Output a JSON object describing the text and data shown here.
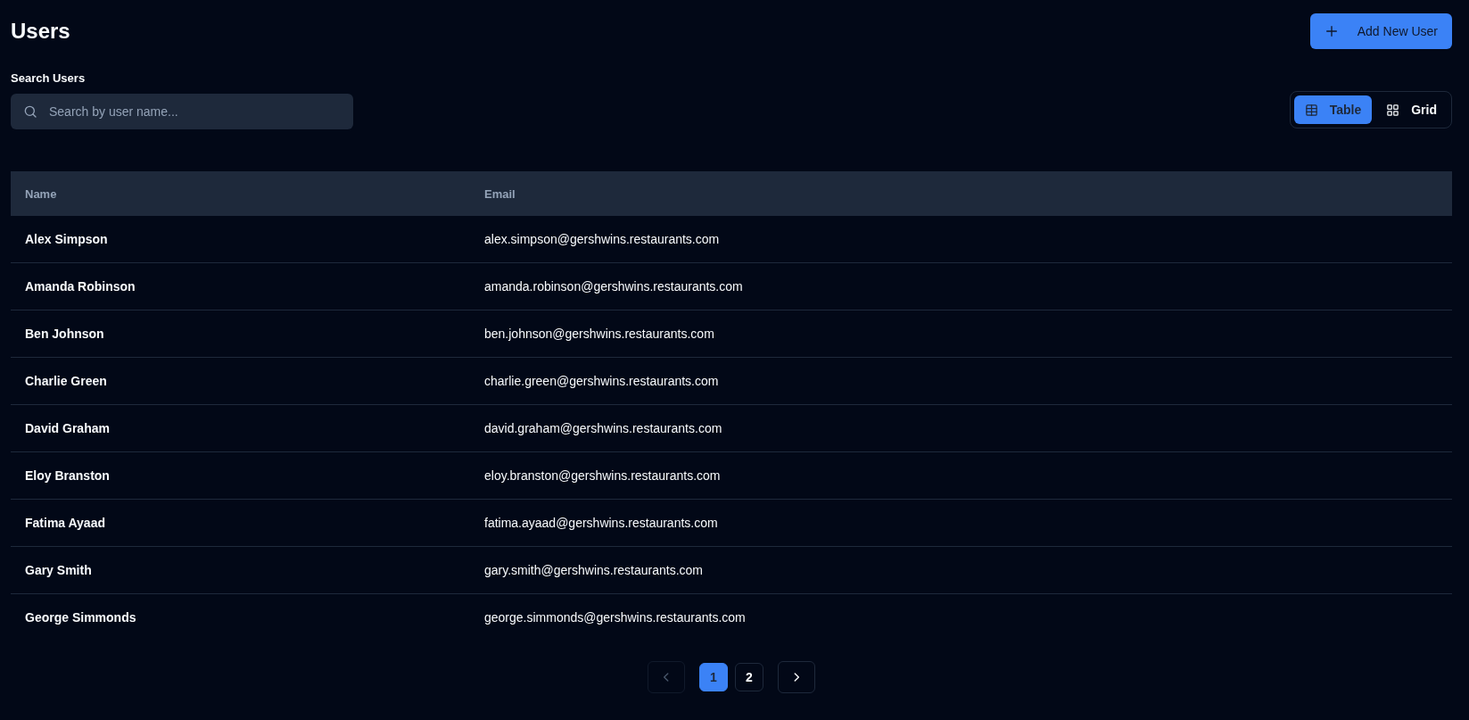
{
  "page": {
    "title": "Users"
  },
  "add_button": {
    "label": "Add New User"
  },
  "search": {
    "label": "Search Users",
    "placeholder": "Search by user name..."
  },
  "view_toggle": [
    {
      "label": "Table",
      "kind": "table",
      "selected": true
    },
    {
      "label": "Grid",
      "kind": "grid",
      "selected": false
    }
  ],
  "table": {
    "columns": [
      "Name",
      "Email"
    ],
    "rows": [
      {
        "name": "Alex Simpson",
        "email": "alex.simpson@gershwins.restaurants.com"
      },
      {
        "name": "Amanda Robinson",
        "email": "amanda.robinson@gershwins.restaurants.com"
      },
      {
        "name": "Ben Johnson",
        "email": "ben.johnson@gershwins.restaurants.com"
      },
      {
        "name": "Charlie Green",
        "email": "charlie.green@gershwins.restaurants.com"
      },
      {
        "name": "David Graham",
        "email": "david.graham@gershwins.restaurants.com"
      },
      {
        "name": "Eloy Branston",
        "email": "eloy.branston@gershwins.restaurants.com"
      },
      {
        "name": "Fatima Ayaad",
        "email": "fatima.ayaad@gershwins.restaurants.com"
      },
      {
        "name": "Gary Smith",
        "email": "gary.smith@gershwins.restaurants.com"
      },
      {
        "name": "George Simmonds",
        "email": "george.simmonds@gershwins.restaurants.com"
      }
    ]
  },
  "pagination": {
    "previous": {
      "disabled": true
    },
    "pages": [
      {
        "label": "1",
        "selected": true
      },
      {
        "label": "2",
        "selected": false
      }
    ],
    "next": {
      "disabled": false
    }
  }
}
